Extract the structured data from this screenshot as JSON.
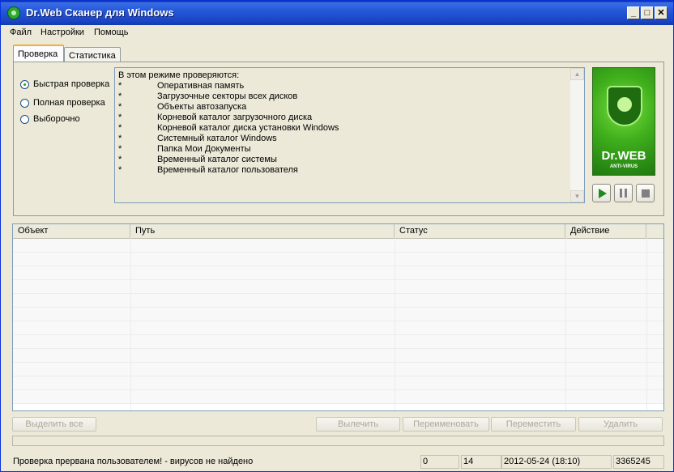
{
  "window": {
    "title": "Dr.Web Сканер для Windows",
    "min_glyph": "_",
    "max_glyph": "□",
    "close_glyph": "✕"
  },
  "menu": [
    "Файл",
    "Настройки",
    "Помощь"
  ],
  "tabs": [
    "Проверка",
    "Статистика"
  ],
  "scan_modes": [
    {
      "label": "Быстрая проверка",
      "checked": true
    },
    {
      "label": "Полная проверка",
      "checked": false
    },
    {
      "label": "Выборочно",
      "checked": false
    }
  ],
  "info": {
    "header": "В этом режиме проверяются:",
    "bullet": "*",
    "items": [
      "Оперативная память",
      "Загрузочные секторы всех дисков",
      "Объекты автозапуска",
      "Корневой каталог загрузочного диска",
      "Корневой каталог диска установки Windows",
      "Системный каталог Windows",
      "Папка Мои Документы",
      "Временный каталог системы",
      "Временный каталог пользователя"
    ]
  },
  "logo": {
    "brand": "Dr.WEB",
    "sub": "ANTI-VIRUS"
  },
  "controls": {
    "play_icon": "play-icon",
    "pause_icon": "pause-icon",
    "stop_icon": "stop-icon"
  },
  "table": {
    "columns": [
      "Объект",
      "Путь",
      "Статус",
      "Действие"
    ],
    "rows": []
  },
  "buttons": {
    "select_all": "Выделить все",
    "cure": "Вылечить",
    "rename": "Переименовать",
    "move": "Переместить",
    "delete": "Удалить"
  },
  "status": {
    "message": "Проверка прервана пользователем! - вирусов не найдено",
    "count1": "0",
    "count2": "14",
    "datetime": "2012-05-24 (18:10)",
    "number": "3365245"
  }
}
